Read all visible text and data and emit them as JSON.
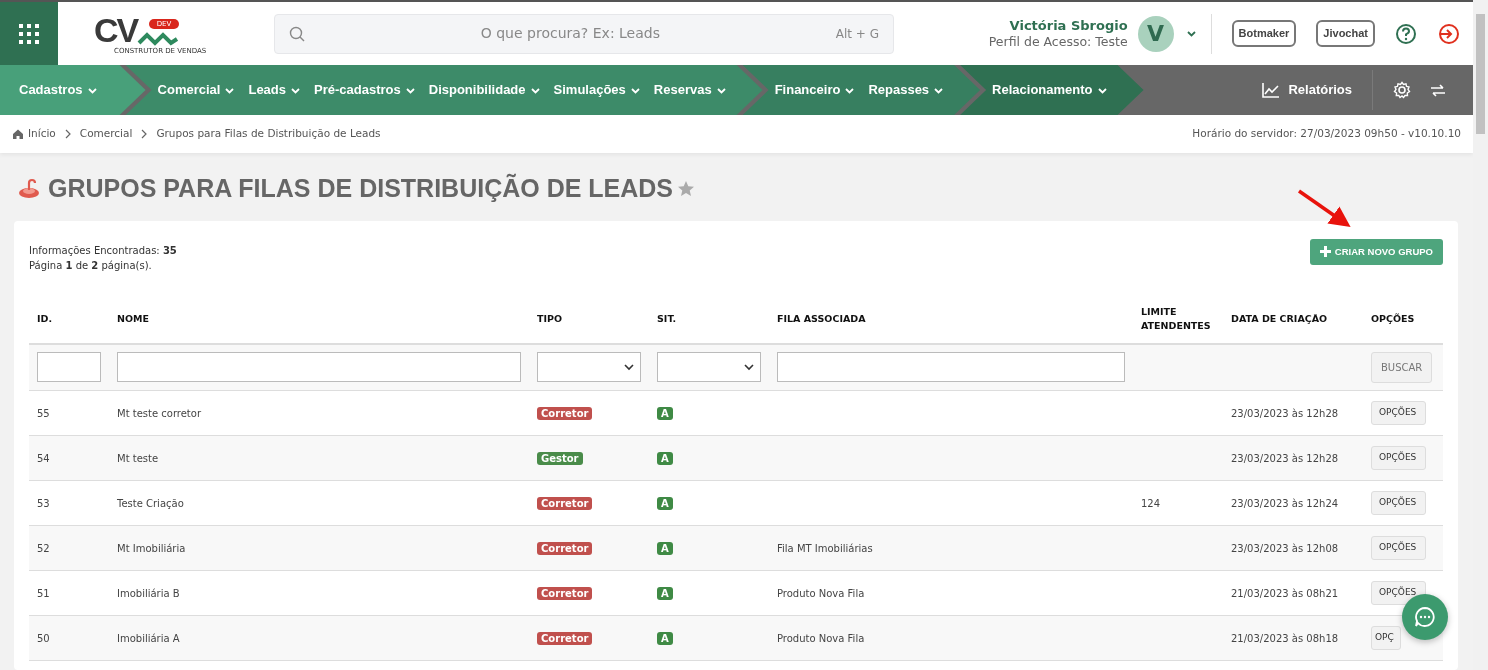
{
  "header": {
    "logo": {
      "mark": "CV",
      "badge": "DEV",
      "tagline": "CONSTRUTOR DE VENDAS"
    },
    "search": {
      "placeholder": "O que procura? Ex: Leads",
      "shortcut": "Alt + G"
    },
    "user": {
      "name": "Victória Sbrogio",
      "profile": "Perfil de Acesso: Teste",
      "initial": "V"
    },
    "buttons": [
      "Botmaker",
      "Jivochat"
    ]
  },
  "nav": {
    "groups": [
      {
        "color": "#48a07a",
        "items": [
          "Cadastros"
        ]
      },
      {
        "color": "#3d8b69",
        "items": [
          "Comercial",
          "Leads",
          "Pré-cadastros",
          "Disponibilidade",
          "Simulações",
          "Reservas"
        ]
      },
      {
        "color": "#377f60",
        "items": [
          "Financeiro",
          "Repasses"
        ]
      },
      {
        "color": "#2f7052",
        "items": [
          "Relacionamento"
        ]
      }
    ],
    "reports": "Relatórios"
  },
  "breadcrumb": {
    "items": [
      "Início",
      "Comercial",
      "Grupos para Filas de Distribuição de Leads"
    ],
    "server_time": "Horário do servidor: 27/03/2023 09h50 - v10.10.10"
  },
  "page": {
    "title": "GRUPOS PARA FILAS DE DISTRIBUIÇÃO DE LEADS",
    "favorite": false
  },
  "summary": [
    "Informações Encontradas: **35**",
    "Página **1** de **2** página(s)."
  ],
  "create_button": "CRIAR NOVO GRUPO",
  "table": {
    "columns": [
      {
        "label": "ID."
      },
      {
        "label": "NOME"
      },
      {
        "label": "TIPO"
      },
      {
        "label": "SIT."
      },
      {
        "label": "FILA ASSOCIADA"
      },
      {
        "label": "LIMITE ATENDENTES"
      },
      {
        "label": "DATA DE CRIAÇÃO"
      },
      {
        "label": "OPÇÕES"
      }
    ],
    "filters": [
      {
        "kind": "input"
      },
      {
        "kind": "input"
      },
      {
        "kind": "select"
      },
      {
        "kind": "select"
      },
      {
        "kind": "input"
      },
      {
        "kind": "empty"
      },
      {
        "kind": "empty"
      },
      {
        "kind": "button"
      }
    ],
    "search_button": "BUSCAR",
    "rows": [
      {
        "id": "55",
        "name": "Mt teste corretor",
        "type": {
          "label": "Corretor",
          "color": "#c0504d"
        },
        "status": {
          "label": "A",
          "color": "#3f8a45"
        },
        "queue": "",
        "limit": "",
        "created": "23/03/2023 às 12h28",
        "options": "OPÇÕES"
      },
      {
        "id": "54",
        "name": "Mt teste",
        "type": {
          "label": "Gestor",
          "color": "#4a8c4a"
        },
        "status": {
          "label": "A",
          "color": "#3f8a45"
        },
        "queue": "",
        "limit": "",
        "created": "23/03/2023 às 12h28",
        "options": "OPÇÕES"
      },
      {
        "id": "53",
        "name": "Teste Criação",
        "type": {
          "label": "Corretor",
          "color": "#c0504d"
        },
        "status": {
          "label": "A",
          "color": "#3f8a45"
        },
        "queue": "",
        "limit": "124",
        "created": "23/03/2023 às 12h24",
        "options": "OPÇÕES"
      },
      {
        "id": "52",
        "name": "Mt Imobiliária",
        "type": {
          "label": "Corretor",
          "color": "#c0504d"
        },
        "status": {
          "label": "A",
          "color": "#3f8a45"
        },
        "queue": "Fila MT Imobiliárias",
        "limit": "",
        "created": "23/03/2023 às 12h08",
        "options": "OPÇÕES"
      },
      {
        "id": "51",
        "name": "Imobiliária B",
        "type": {
          "label": "Corretor",
          "color": "#c0504d"
        },
        "status": {
          "label": "A",
          "color": "#3f8a45"
        },
        "queue": "Produto Nova Fila",
        "limit": "",
        "created": "21/03/2023 às 08h21",
        "options": "OPÇÕES"
      },
      {
        "id": "50",
        "name": "Imobiliária A",
        "type": {
          "label": "Corretor",
          "color": "#c0504d"
        },
        "status": {
          "label": "A",
          "color": "#3f8a45"
        },
        "queue": "Produto Nova Fila",
        "limit": "",
        "created": "21/03/2023 às 08h18",
        "options": "OPÇ"
      }
    ]
  }
}
